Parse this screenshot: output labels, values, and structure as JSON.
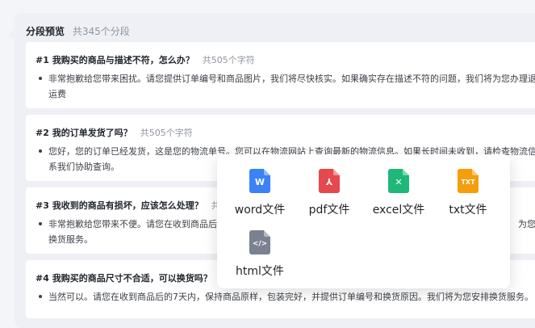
{
  "panel": {
    "title": "分段预览",
    "count": "共345个分段"
  },
  "segments": [
    {
      "title": "#1 我购买的商品与描述不符，怎么办？",
      "chars": "共505个字符",
      "line1": "非常抱歉给您带来困扰。请您提供订单编号和商品图片，我们将尽快核实。如果确实存在描述不符的问题，我们将为您办理退",
      "line2": "运费"
    },
    {
      "title": "#2 我的订单发货了吗？",
      "chars": "共505个字符",
      "line1": "您好，您的订单已经发货，这是您的物流单号。您可以在物流网站上查询最新的物流信息。如果长时间未收到，请检查物流信",
      "line2": "系我们协助查询。"
    },
    {
      "title": "#3 我收到的商品有损坏，应该怎么处理？",
      "chars": "共5",
      "line1": "非常抱歉给您带来不便。请您在收到商品后",
      "line1b": "为您",
      "line2": "换货服务。"
    },
    {
      "title": "#4 我购买的商品尺寸不合适，可以换货吗？",
      "chars": "共",
      "line1": "当然可以。请您在收到商品后的7天内，保持商品原样，包装完好，并提供订单编号和换货原因。我们将为您安排换货服务。"
    }
  ],
  "export_menu": {
    "options": [
      {
        "label": "word文件",
        "icon": "word-file-icon",
        "glyph": "W",
        "color": "#3b82f6"
      },
      {
        "label": "pdf文件",
        "icon": "pdf-file-icon",
        "glyph": "⅄",
        "color": "#e5484d"
      },
      {
        "label": "excel文件",
        "icon": "excel-file-icon",
        "glyph": "✕",
        "color": "#1fb87a"
      },
      {
        "label": "txt文件",
        "icon": "txt-file-icon",
        "glyph": "TXT",
        "color": "#f59e0b"
      },
      {
        "label": "html文件",
        "icon": "html-file-icon",
        "glyph": "</>",
        "color": "#7a8291"
      }
    ]
  }
}
